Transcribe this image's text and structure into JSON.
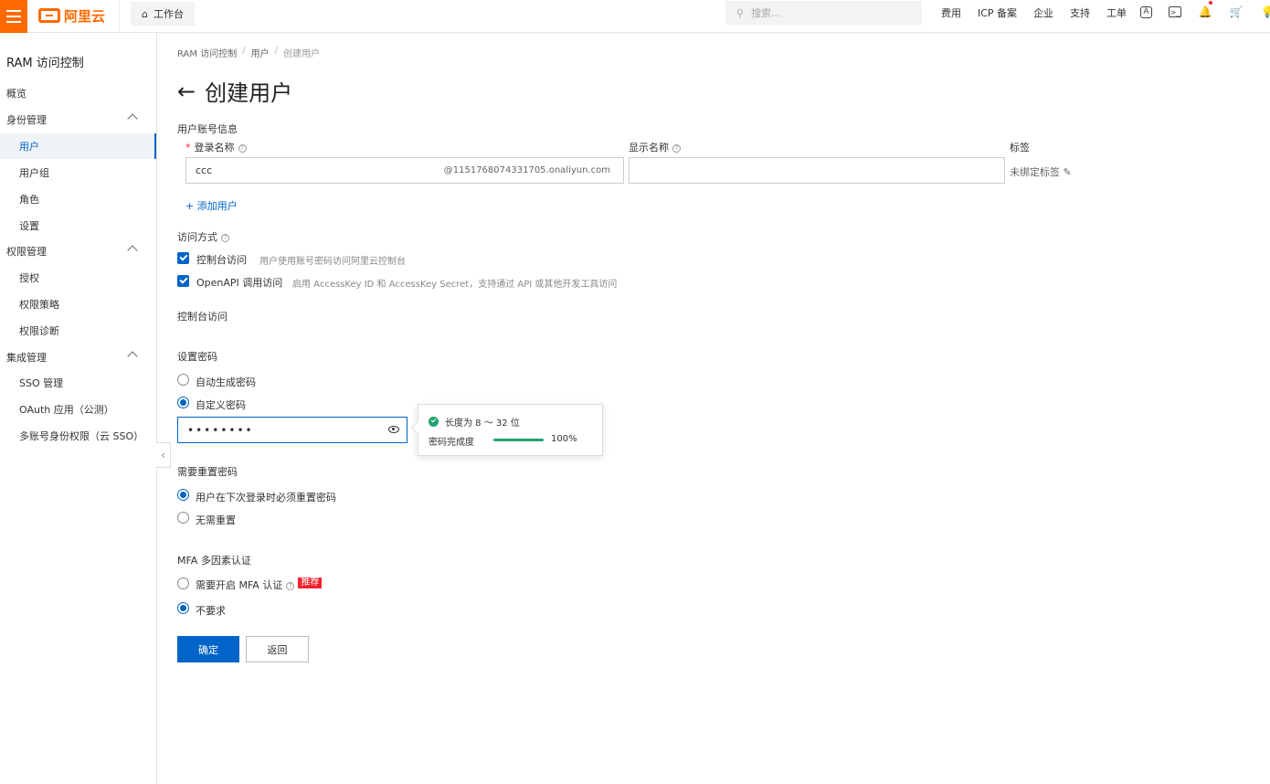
{
  "topbar": {
    "brand": "阿里云",
    "workbench": "工作台",
    "search_placeholder": "搜索...",
    "nav": [
      "费用",
      "ICP 备案",
      "企业",
      "支持",
      "工单"
    ]
  },
  "sidebar": {
    "title": "RAM 访问控制",
    "items": [
      {
        "label": "概览"
      },
      {
        "label": "身份管理"
      },
      {
        "label": "用户"
      },
      {
        "label": "用户组"
      },
      {
        "label": "角色"
      },
      {
        "label": "设置"
      },
      {
        "label": "权限管理"
      },
      {
        "label": "授权"
      },
      {
        "label": "权限策略"
      },
      {
        "label": "权限诊断"
      },
      {
        "label": "集成管理"
      },
      {
        "label": "SSO 管理"
      },
      {
        "label": "OAuth 应用（公测）"
      },
      {
        "label": "多账号身份权限（云 SSO）"
      }
    ]
  },
  "breadcrumb": [
    "RAM 访问控制",
    "用户",
    "创建用户"
  ],
  "page_title": "创建用户",
  "account": {
    "section": "用户账号信息",
    "login_label": "登录名称",
    "login_value": "ccc",
    "login_suffix": "@1151768074331705.onaliyun.com",
    "display_label": "显示名称",
    "display_value": "",
    "tag_label": "标签",
    "tag_value": "未绑定标签",
    "add_user": "添加用户"
  },
  "access": {
    "section": "访问方式",
    "console_label": "控制台访问",
    "console_desc": "用户使用账号密码访问阿里云控制台",
    "api_label": "OpenAPI 调用访问",
    "api_desc": "启用 AccessKey ID 和 AccessKey Secret，支持通过 API 或其他开发工具访问",
    "console_section": "控制台访问"
  },
  "password": {
    "section": "设置密码",
    "auto": "自动生成密码",
    "custom": "自定义密码",
    "value": "••••••••",
    "rule": "长度为 8 ～ 32 位",
    "completeness_label": "密码完成度",
    "completeness_value": "100%",
    "completeness_fraction": 1.0
  },
  "reset": {
    "section": "需要重置密码",
    "must": "用户在下次登录时必须重置密码",
    "none": "无需重置"
  },
  "mfa": {
    "section": "MFA 多因素认证",
    "require": "需要开启 MFA 认证",
    "hot": "推荐",
    "none": "不要求"
  },
  "buttons": {
    "ok": "确定",
    "back": "返回"
  },
  "colors": {
    "brand": "#ff6a00",
    "primary": "#0064c8",
    "success": "#23a36d",
    "danger": "#f5222d"
  }
}
